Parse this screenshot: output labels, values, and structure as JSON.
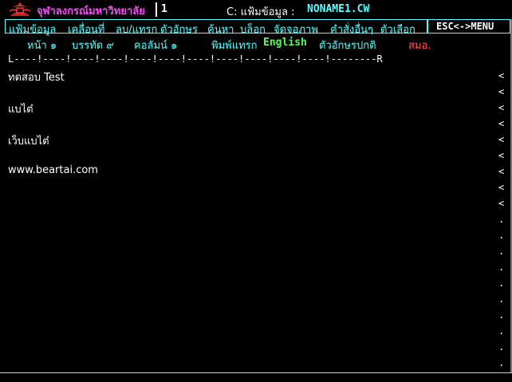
{
  "titlebar": {
    "app_name": "จุฬาลงกรณ์มหาวิทยาลัย",
    "doc_number": "1",
    "file_label": "C: แฟ้มข้อมูล :",
    "file_name": "NONAME1.CW"
  },
  "menubar": {
    "items": [
      "แฟ้มข้อมูล",
      "เคลื่อนที่",
      "ลบ/แทรก",
      "ตัวอักษร",
      "ค้นหา",
      "บล็อก",
      "จัดจอภาพ",
      "คำสั่งอื่นๆ",
      "ตัวเลือก"
    ],
    "esc_label": "ESC<->MENU"
  },
  "status": {
    "page": "หน้า ๑",
    "line": "บรรทัด ๙",
    "column": "คอลัมน์ ๑",
    "mode": "พิมพ์แทรก",
    "language": "English",
    "font_style": "ตัวอักษรปกติ",
    "align": "สมอ."
  },
  "ruler": {
    "text": "L----!----!----!----!----!----!----!----!----!----!----!--------R"
  },
  "document": {
    "lines": [
      "ทดสอบ Test",
      "",
      "แบไต๋",
      "",
      "เว็บแบไต๋",
      "",
      "www.beartai.com"
    ]
  },
  "colors": {
    "background": "#000000",
    "accent": "#55ffff",
    "title_brand": "#ff44ff",
    "status_green": "#55ff55",
    "align_red": "#ff5555"
  }
}
